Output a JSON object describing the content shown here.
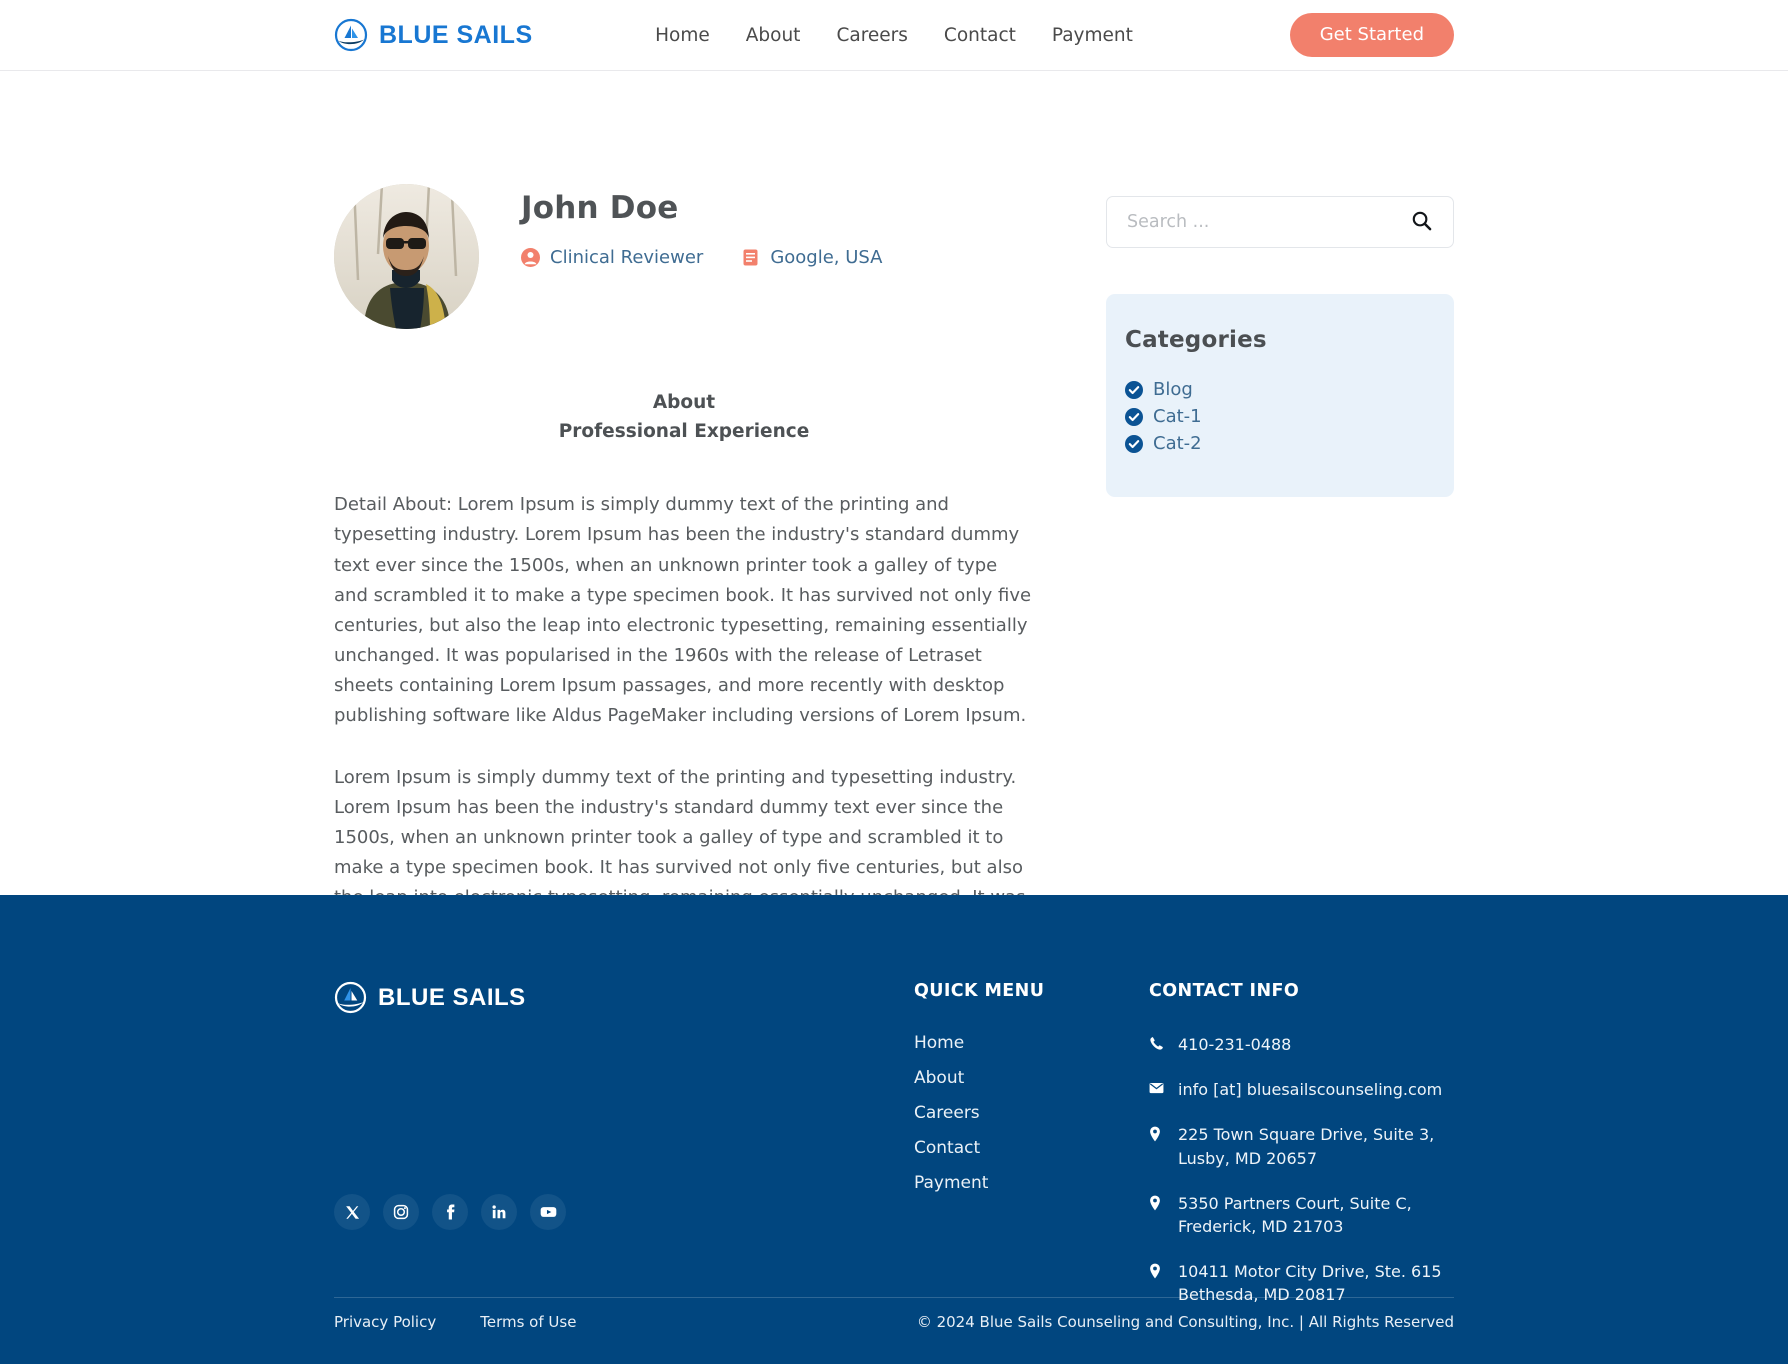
{
  "header": {
    "brand": "BLUE SAILS",
    "logo_icon": "sailboat-circle-icon",
    "nav": [
      {
        "label": "Home"
      },
      {
        "label": "About"
      },
      {
        "label": "Careers"
      },
      {
        "label": "Contact"
      },
      {
        "label": "Payment"
      }
    ],
    "cta_label": "Get Started",
    "cta_color": "#f2806c",
    "brand_color": "#1877d2"
  },
  "profile": {
    "avatar_alt": "profile-photo",
    "name": "John Doe",
    "role_icon": "user-circle-icon",
    "role": "Clinical Reviewer",
    "company_icon": "id-card-icon",
    "company": "Google, USA",
    "meta_color": "#3f6c92",
    "icon_color": "#f2806c"
  },
  "about": {
    "heading_1": "About",
    "heading_2": "Professional Experience",
    "paragraphs": [
      "Detail About: Lorem Ipsum is simply dummy text of the printing and typesetting industry. Lorem Ipsum has been the industry's standard dummy text ever since the 1500s, when an unknown printer took a galley of type and scrambled it to make a type specimen book. It has survived not only five centuries, but also the leap into electronic typesetting, remaining essentially unchanged. It was popularised in the 1960s with the release of Letraset sheets containing Lorem Ipsum passages, and more recently with desktop publishing software like Aldus PageMaker including versions of Lorem Ipsum.",
      "Lorem Ipsum is simply dummy text of the printing and typesetting industry. Lorem Ipsum has been the industry's standard dummy text ever since the 1500s, when an unknown printer took a galley of type and scrambled it to make a type specimen book. It has survived not only five centuries, but also the leap into electronic typesetting, remaining essentially unchanged. It was popularised in the 1960s with the release of Letraset sheets containing Lorem Ipsum passages, and more recently with desktop publishing software like Aldus PageMaker including versions of Lorem Ipsum."
    ]
  },
  "sidebar": {
    "search": {
      "value": "",
      "placeholder": "Search ...",
      "icon": "search-icon"
    },
    "categories": {
      "title": "Categories",
      "panel_color": "#e9f2fa",
      "check_color": "#0b5394",
      "items": [
        {
          "label": "Blog",
          "icon": "check-circle-icon"
        },
        {
          "label": "Cat-1",
          "icon": "check-circle-icon"
        },
        {
          "label": "Cat-2",
          "icon": "check-circle-icon"
        }
      ]
    }
  },
  "footer": {
    "background": "#01467f",
    "brand": "BLUE SAILS",
    "logo_icon": "sailboat-circle-icon",
    "socials": [
      {
        "name": "x-twitter-icon"
      },
      {
        "name": "instagram-icon"
      },
      {
        "name": "facebook-icon"
      },
      {
        "name": "linkedin-icon"
      },
      {
        "name": "youtube-icon"
      }
    ],
    "quick_menu": {
      "title": "QUICK MENU",
      "items": [
        {
          "label": "Home"
        },
        {
          "label": "About"
        },
        {
          "label": "Careers"
        },
        {
          "label": "Contact"
        },
        {
          "label": "Payment"
        }
      ]
    },
    "contact": {
      "title": "CONTACT INFO",
      "items": [
        {
          "icon": "phone-icon",
          "text": "410-231-0488"
        },
        {
          "icon": "envelope-icon",
          "text": "info [at] bluesailscounseling.com"
        },
        {
          "icon": "map-pin-icon",
          "text": "225 Town Square Drive, Suite 3, Lusby, MD 20657"
        },
        {
          "icon": "map-pin-icon",
          "text": "5350 Partners Court, Suite C, Frederick, MD 21703"
        },
        {
          "icon": "map-pin-icon",
          "text": "10411 Motor City Drive, Ste. 615 Bethesda, MD 20817"
        }
      ]
    },
    "legal": [
      {
        "label": "Privacy Policy"
      },
      {
        "label": "Terms of Use"
      }
    ],
    "copyright": "© 2024 Blue Sails Counseling and Consulting, Inc. | All Rights Reserved"
  }
}
